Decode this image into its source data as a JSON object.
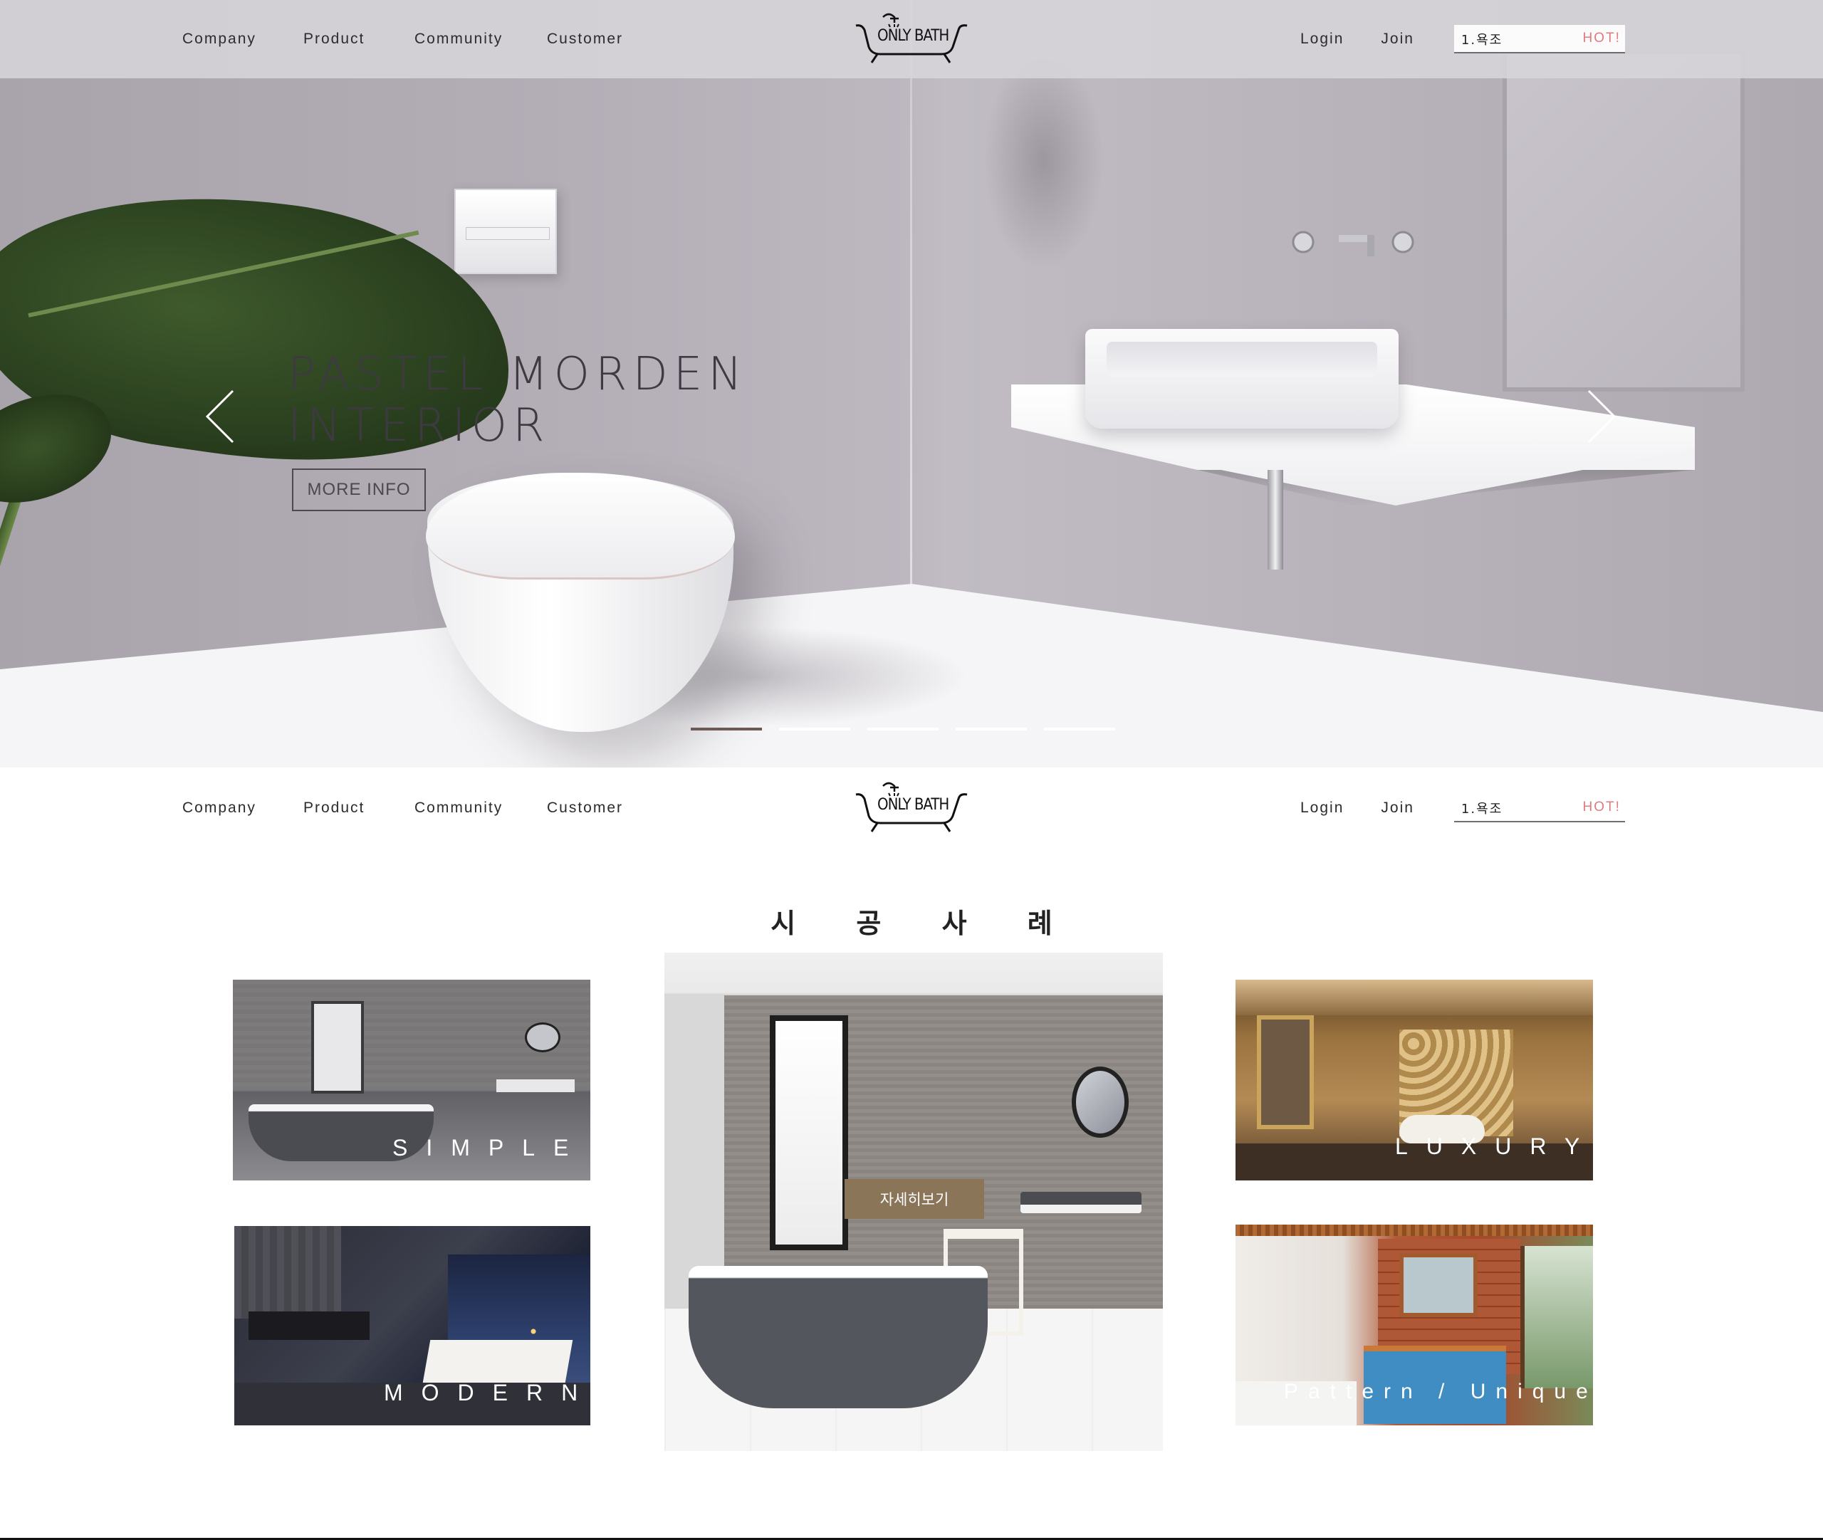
{
  "nav": {
    "menu": [
      "Company",
      "Product",
      "Community",
      "Customer"
    ],
    "logo_text": "ONLY BATH",
    "login": "Login",
    "join": "Join",
    "search_value": "1.욕조",
    "hot_label": "HOT!"
  },
  "hero": {
    "headline_line1": "PASTEL MORDEN",
    "headline_line2": "INTERIOR",
    "more_button": "MORE INFO",
    "slides_count": 5,
    "active_slide": 1
  },
  "cases": {
    "title": "시 공 사 례",
    "cards": {
      "simple": "SIMPLE",
      "luxury": "LUXURY",
      "modern": "MODERN",
      "pattern": "Pattern / Unique"
    },
    "featured_button": "자세히보기"
  },
  "colors": {
    "hot_accent": "#e07a7f",
    "detail_button": "#8b7559",
    "active_dot": "#6e5a55",
    "hero_wall": "#bdb7c0"
  }
}
